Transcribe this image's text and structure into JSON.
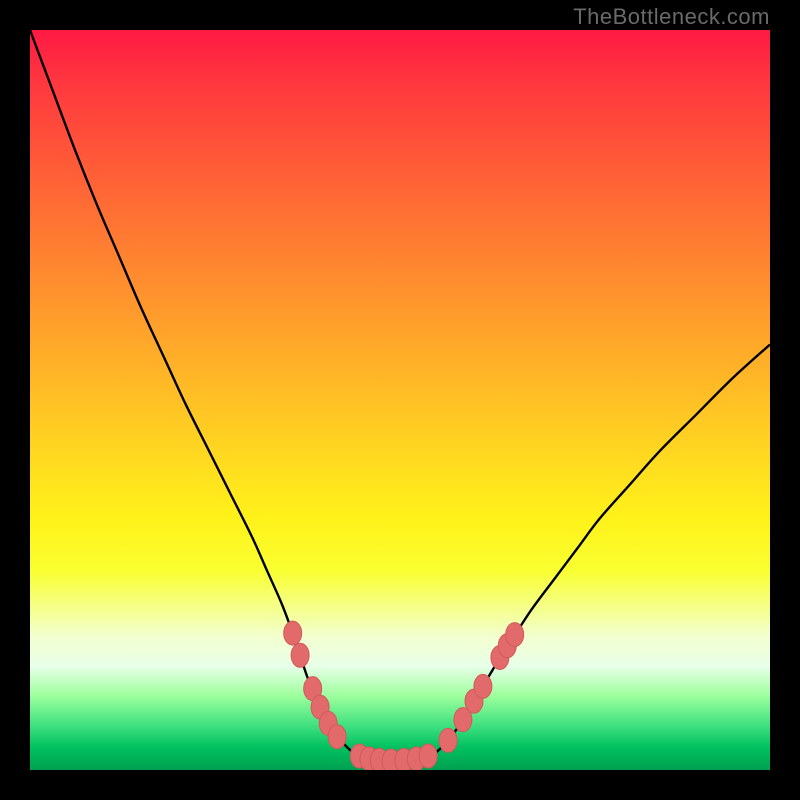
{
  "watermark": "TheBottleneck.com",
  "colors": {
    "curve_stroke": "#000000",
    "marker_fill": "#e26a6a",
    "marker_stroke": "#d15a5a",
    "gradient_top": "#ff1a44",
    "gradient_bottom": "#00a050",
    "frame_bg": "#000000"
  },
  "chart_data": {
    "type": "line",
    "title": "",
    "xlabel": "",
    "ylabel": "",
    "xlim": [
      0,
      100
    ],
    "ylim": [
      0,
      100
    ],
    "grid": false,
    "curve": {
      "name": "bottleneck-curve",
      "points": [
        {
          "x": 0.0,
          "y": 100.0
        },
        {
          "x": 3.0,
          "y": 92.0
        },
        {
          "x": 6.0,
          "y": 84.0
        },
        {
          "x": 9.0,
          "y": 76.5
        },
        {
          "x": 12.0,
          "y": 69.5
        },
        {
          "x": 15.0,
          "y": 62.5
        },
        {
          "x": 18.0,
          "y": 56.0
        },
        {
          "x": 21.0,
          "y": 49.5
        },
        {
          "x": 24.0,
          "y": 43.5
        },
        {
          "x": 27.0,
          "y": 37.5
        },
        {
          "x": 30.0,
          "y": 31.5
        },
        {
          "x": 32.0,
          "y": 27.0
        },
        {
          "x": 34.0,
          "y": 22.5
        },
        {
          "x": 35.5,
          "y": 18.5
        },
        {
          "x": 36.5,
          "y": 15.5
        },
        {
          "x": 37.5,
          "y": 12.5
        },
        {
          "x": 38.5,
          "y": 10.0
        },
        {
          "x": 39.5,
          "y": 8.0
        },
        {
          "x": 40.5,
          "y": 6.0
        },
        {
          "x": 42.0,
          "y": 4.0
        },
        {
          "x": 43.5,
          "y": 2.5
        },
        {
          "x": 45.0,
          "y": 1.7
        },
        {
          "x": 46.5,
          "y": 1.3
        },
        {
          "x": 48.0,
          "y": 1.2
        },
        {
          "x": 50.0,
          "y": 1.2
        },
        {
          "x": 52.0,
          "y": 1.3
        },
        {
          "x": 53.5,
          "y": 1.7
        },
        {
          "x": 55.0,
          "y": 2.5
        },
        {
          "x": 56.5,
          "y": 4.0
        },
        {
          "x": 58.0,
          "y": 6.0
        },
        {
          "x": 59.5,
          "y": 8.5
        },
        {
          "x": 61.0,
          "y": 11.0
        },
        {
          "x": 62.5,
          "y": 13.5
        },
        {
          "x": 64.0,
          "y": 16.0
        },
        {
          "x": 66.0,
          "y": 19.0
        },
        {
          "x": 68.0,
          "y": 22.0
        },
        {
          "x": 71.0,
          "y": 26.0
        },
        {
          "x": 74.0,
          "y": 30.0
        },
        {
          "x": 77.0,
          "y": 34.0
        },
        {
          "x": 81.0,
          "y": 38.5
        },
        {
          "x": 85.0,
          "y": 43.0
        },
        {
          "x": 90.0,
          "y": 48.0
        },
        {
          "x": 95.0,
          "y": 53.0
        },
        {
          "x": 100.0,
          "y": 57.5
        }
      ]
    },
    "markers_left": [
      {
        "x": 35.5,
        "y": 18.5
      },
      {
        "x": 36.5,
        "y": 15.5
      },
      {
        "x": 38.2,
        "y": 11.0
      },
      {
        "x": 39.2,
        "y": 8.5
      },
      {
        "x": 40.3,
        "y": 6.3
      },
      {
        "x": 41.5,
        "y": 4.5
      }
    ],
    "markers_bottom": [
      {
        "x": 44.5,
        "y": 1.9
      },
      {
        "x": 45.8,
        "y": 1.5
      },
      {
        "x": 47.2,
        "y": 1.3
      },
      {
        "x": 48.8,
        "y": 1.2
      },
      {
        "x": 50.5,
        "y": 1.3
      },
      {
        "x": 52.2,
        "y": 1.5
      },
      {
        "x": 53.8,
        "y": 1.9
      }
    ],
    "markers_right": [
      {
        "x": 56.5,
        "y": 4.0
      },
      {
        "x": 58.5,
        "y": 6.8
      },
      {
        "x": 60.0,
        "y": 9.3
      },
      {
        "x": 61.2,
        "y": 11.3
      },
      {
        "x": 63.5,
        "y": 15.2
      },
      {
        "x": 64.5,
        "y": 16.8
      },
      {
        "x": 65.5,
        "y": 18.3
      }
    ]
  }
}
